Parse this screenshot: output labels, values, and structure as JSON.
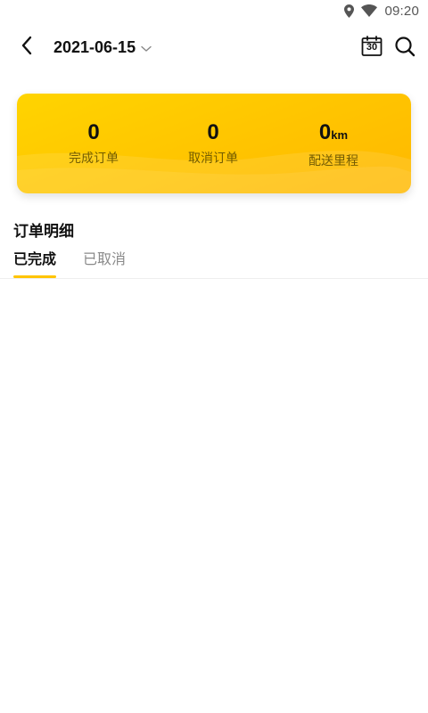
{
  "status_bar": {
    "time": "09:20",
    "icons": [
      "location-pin-icon",
      "wifi-icon"
    ]
  },
  "header": {
    "back_icon": "chevron-left-icon",
    "date": "2021-06-15",
    "date_dropdown_icon": "chevron-down-icon",
    "calendar_icon": "calendar-icon",
    "calendar_day": "30",
    "search_icon": "search-icon"
  },
  "summary": {
    "completed": {
      "value": "0",
      "label": "完成订单"
    },
    "cancelled": {
      "value": "0",
      "label": "取消订单"
    },
    "distance": {
      "value": "0",
      "unit": "km",
      "label": "配送里程"
    }
  },
  "details": {
    "title": "订单明细",
    "tabs": [
      {
        "label": "已完成",
        "active": true
      },
      {
        "label": "已取消",
        "active": false
      }
    ]
  },
  "colors": {
    "accent": "#FFC400",
    "card_top": "#FFD400",
    "card_bottom": "#FFB800",
    "inactive_tab": "#8a8a8a"
  }
}
